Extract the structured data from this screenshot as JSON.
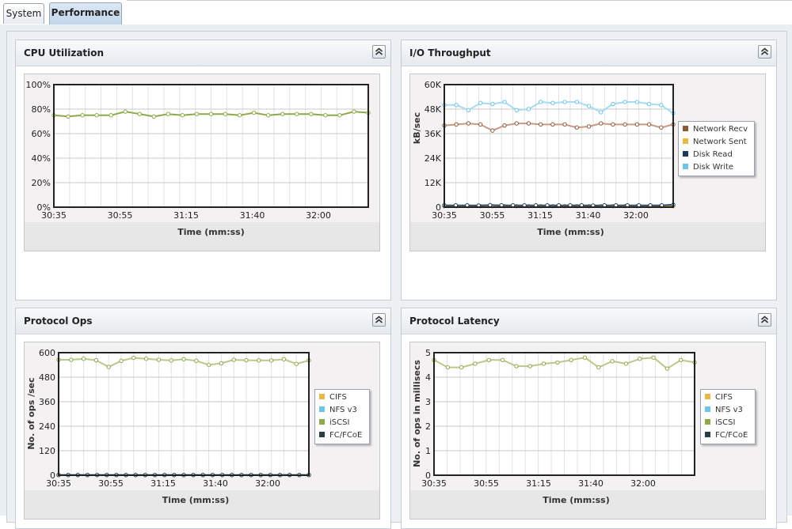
{
  "tabs": [
    {
      "label": "System",
      "active": false
    },
    {
      "label": "Performance",
      "active": true
    }
  ],
  "panels": {
    "cpu": {
      "title": "CPU Utilization",
      "chart_data": {
        "type": "line",
        "xlabel": "Time (mm:ss)",
        "ylabel": "",
        "x_ticks": [
          "30:35",
          "30:55",
          "31:15",
          "31:40",
          "32:00"
        ],
        "y_ticks": [
          "0%",
          "20%",
          "40%",
          "60%",
          "80%",
          "100%"
        ],
        "ylim": [
          0,
          100
        ],
        "grid": true,
        "legend": "none",
        "series": [
          {
            "color": "#8fa84a",
            "values": [
              75,
              74,
              75,
              75,
              75,
              78,
              76,
              74,
              76,
              75,
              76,
              76,
              76,
              75,
              77,
              75,
              76,
              76,
              76,
              75,
              75,
              78,
              77
            ]
          }
        ]
      }
    },
    "io": {
      "title": "I/O Throughput",
      "chart_data": {
        "type": "line",
        "xlabel": "Time (mm:ss)",
        "ylabel": "kB/sec",
        "x_ticks": [
          "30:35",
          "30:55",
          "31:15",
          "31:40",
          "32:00"
        ],
        "y_ticks": [
          "0",
          "12K",
          "24K",
          "36K",
          "48K",
          "60K"
        ],
        "ylim": [
          0,
          60000
        ],
        "grid": true,
        "legend": "right",
        "series": [
          {
            "name": "Network Recv",
            "color": "#8a5a3a",
            "line": "#c89a86",
            "values": [
              40000,
              40500,
              41000,
              40500,
              37500,
              40000,
              41000,
              41000,
              40500,
              40500,
              40500,
              39000,
              39500,
              41000,
              40500,
              40500,
              40500,
              40500,
              39000,
              40500
            ]
          },
          {
            "name": "Network Sent",
            "color": "#e8b84a",
            "line": "#e8b84a",
            "values": [
              500,
              500,
              500,
              500,
              500,
              500,
              500,
              500,
              500,
              500,
              500,
              500,
              500,
              500,
              500,
              500,
              500,
              500,
              500,
              500
            ]
          },
          {
            "name": "Disk Read",
            "color": "#1c3a5a",
            "line": "#2a4a6a",
            "values": [
              900,
              900,
              900,
              800,
              1000,
              900,
              900,
              900,
              900,
              900,
              900,
              900,
              900,
              800,
              900,
              900,
              900,
              900,
              900,
              900,
              1200
            ]
          },
          {
            "name": "Disk Write",
            "color": "#6ec3e6",
            "line": "#a8dbf2",
            "values": [
              50000,
              50000,
              47500,
              51000,
              50500,
              51500,
              47500,
              48000,
              51500,
              51000,
              51500,
              51500,
              49500,
              46500,
              50500,
              51500,
              51500,
              50500,
              50000,
              46000
            ]
          }
        ]
      }
    },
    "proto": {
      "title": "Protocol Ops",
      "chart_data": {
        "type": "line",
        "xlabel": "Time (mm:ss)",
        "ylabel": "No. of ops /sec",
        "x_ticks": [
          "30:35",
          "30:55",
          "31:15",
          "31:40",
          "32:00"
        ],
        "y_ticks": [
          "0",
          "120",
          "240",
          "360",
          "480",
          "600"
        ],
        "ylim": [
          0,
          600
        ],
        "grid": true,
        "legend": "right",
        "series": [
          {
            "name": "CIFS",
            "color": "#e8b84a",
            "line": "#e8b84a",
            "values": [
              1,
              1,
              1,
              1,
              1,
              1,
              1,
              1,
              1,
              1,
              1,
              1,
              1,
              1,
              1,
              1,
              1,
              1,
              1,
              1,
              1,
              1,
              1,
              1,
              1,
              1,
              1
            ]
          },
          {
            "name": "NFS v3",
            "color": "#6ec3e6",
            "line": "#6ec3e6",
            "values": [
              2,
              2,
              2,
              2,
              2,
              2,
              2,
              2,
              2,
              2,
              2,
              2,
              2,
              2,
              2,
              2,
              2,
              2,
              2,
              2,
              2,
              2,
              2,
              2,
              2,
              2,
              2
            ]
          },
          {
            "name": "iSCSI",
            "color": "#8fa84a",
            "line": "#b9c98a",
            "values": [
              565,
              565,
              570,
              563,
              530,
              560,
              575,
              570,
              565,
              562,
              568,
              560,
              540,
              548,
              565,
              563,
              562,
              562,
              568,
              545,
              562
            ]
          },
          {
            "name": "FC/FCoE",
            "color": "#2a3e45",
            "line": "#5f7077",
            "values": [
              1,
              1,
              1,
              1,
              1,
              1,
              1,
              1,
              1,
              1,
              1,
              1,
              1,
              1,
              1,
              1,
              1,
              1,
              1,
              1,
              1,
              1,
              1,
              1,
              1,
              1,
              1
            ]
          }
        ]
      }
    },
    "latency": {
      "title": "Protocol Latency",
      "chart_data": {
        "type": "line",
        "xlabel": "Time (mm:ss)",
        "ylabel": "No. of ops in millisecs",
        "x_ticks": [
          "30:35",
          "30:55",
          "31:15",
          "31:40",
          "32:00"
        ],
        "y_ticks": [
          "0",
          "1",
          "2",
          "3",
          "4",
          "5"
        ],
        "ylim": [
          0,
          5
        ],
        "grid": true,
        "legend": "right",
        "series": [
          {
            "name": "CIFS",
            "color": "#e8b84a",
            "line": "#e8b84a",
            "values": []
          },
          {
            "name": "NFS v3",
            "color": "#6ec3e6",
            "line": "#6ec3e6",
            "values": []
          },
          {
            "name": "iSCSI",
            "color": "#8fa84a",
            "line": "#b9c98a",
            "values": [
              4.7,
              4.4,
              4.4,
              4.55,
              4.7,
              4.7,
              4.45,
              4.45,
              4.55,
              4.6,
              4.7,
              4.8,
              4.4,
              4.65,
              4.55,
              4.75,
              4.8,
              4.35,
              4.7,
              4.6
            ]
          },
          {
            "name": "FC/FCoE",
            "color": "#2a3e45",
            "line": "#5f7077",
            "values": []
          }
        ]
      }
    }
  }
}
